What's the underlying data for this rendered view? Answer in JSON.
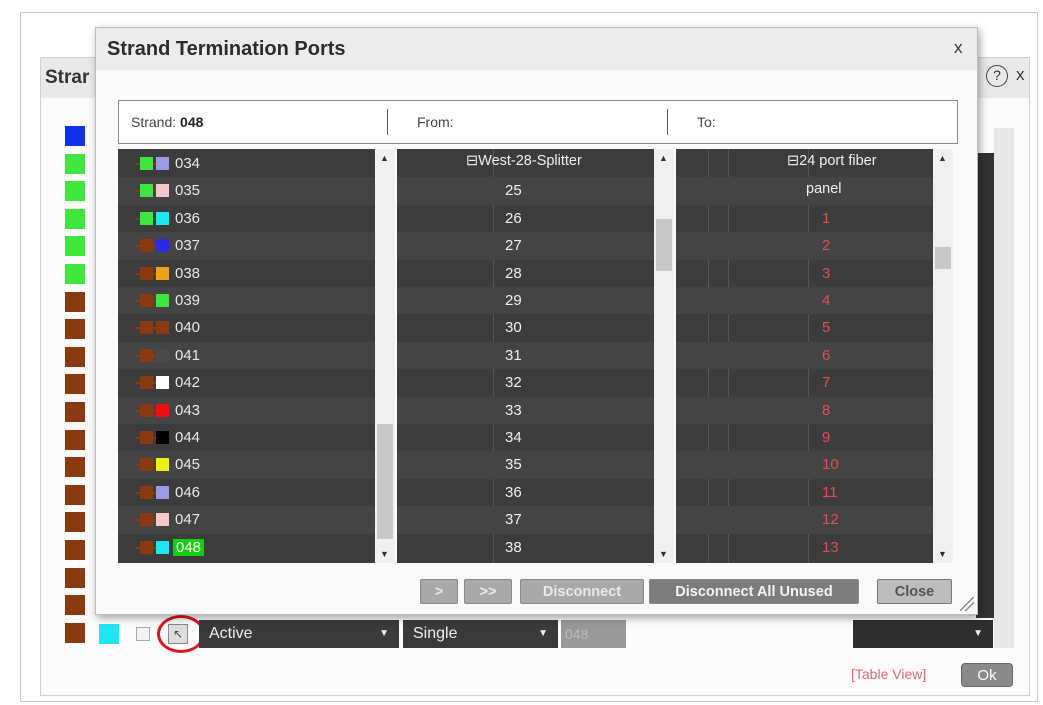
{
  "background_dialog": {
    "title": "Strar",
    "help_icon_text": "?",
    "close_text": "x",
    "status_select": "Active",
    "mode_select": "Single",
    "strand_field": "048",
    "table_view_link": "[Table View]",
    "ok_label": "Ok"
  },
  "modal": {
    "title": "Strand Termination Ports",
    "close_text": "x",
    "header": {
      "strand_label": "Strand:",
      "strand_value": "048",
      "from_label": "From:",
      "to_label": "To:"
    },
    "strands": [
      {
        "label": "034",
        "c1": "#3ee63e",
        "c2": "#9a9ae6"
      },
      {
        "label": "035",
        "c1": "#3ee63e",
        "c2": "#f4c8c8"
      },
      {
        "label": "036",
        "c1": "#3ee63e",
        "c2": "#1ee6f0"
      },
      {
        "label": "037",
        "c1": "#8b3a10",
        "c2": "#2a2ae6"
      },
      {
        "label": "038",
        "c1": "#8b3a10",
        "c2": "#f0a020"
      },
      {
        "label": "039",
        "c1": "#8b3a10",
        "c2": "#3ee63e"
      },
      {
        "label": "040",
        "c1": "#8b3a10",
        "c2": "#8b3a10"
      },
      {
        "label": "041",
        "c1": "#8b3a10",
        "c2": "#4a4a4a"
      },
      {
        "label": "042",
        "c1": "#8b3a10",
        "c2": "#ffffff"
      },
      {
        "label": "043",
        "c1": "#8b3a10",
        "c2": "#ee1010"
      },
      {
        "label": "044",
        "c1": "#8b3a10",
        "c2": "#000000"
      },
      {
        "label": "045",
        "c1": "#8b3a10",
        "c2": "#f0f010"
      },
      {
        "label": "046",
        "c1": "#8b3a10",
        "c2": "#9a9ae6"
      },
      {
        "label": "047",
        "c1": "#8b3a10",
        "c2": "#f4c8c8"
      },
      {
        "label": "048",
        "c1": "#8b3a10",
        "c2": "#1ee6f0",
        "selected": true
      }
    ],
    "from_tree_label": "⊟West-28-Splitter",
    "from_ports": [
      "25",
      "26",
      "27",
      "28",
      "29",
      "30",
      "31",
      "32",
      "33",
      "34",
      "35",
      "36",
      "37",
      "38"
    ],
    "to_tree_label": "⊟24 port fiber",
    "to_tree_label_2": "panel",
    "to_ports": [
      "1",
      "2",
      "3",
      "4",
      "5",
      "6",
      "7",
      "8",
      "9",
      "10",
      "11",
      "12",
      "13"
    ],
    "buttons": {
      "connect": ">",
      "connect_all": ">>",
      "disconnect": "Disconnect",
      "disconnect_all_unused": "Disconnect All Unused",
      "close": "Close"
    }
  },
  "colors": {
    "green": "#3ee63e",
    "brown": "#8b3a10",
    "blue": "#1030e6",
    "cyan": "#1ee6f0",
    "port_text": "#e05050",
    "highlight_ring": "#e0141e"
  }
}
